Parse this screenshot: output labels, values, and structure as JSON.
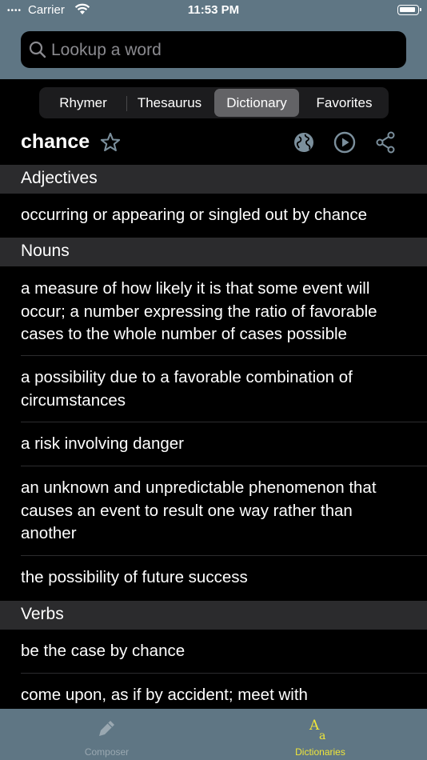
{
  "status_bar": {
    "carrier": "Carrier",
    "time": "11:53 PM",
    "dots": "••••"
  },
  "search": {
    "placeholder": "Lookup a word",
    "icon": "search-icon"
  },
  "segments": {
    "items": [
      "Rhymer",
      "Thesaurus",
      "Dictionary",
      "Favorites"
    ],
    "selected": "Dictionary"
  },
  "entry": {
    "word": "chance",
    "icons": [
      "star-icon",
      "globe-icon",
      "play-icon",
      "share-icon"
    ]
  },
  "sections": [
    {
      "title": "Adjectives",
      "definitions": [
        "occurring or appearing or singled out by chance"
      ]
    },
    {
      "title": "Nouns",
      "definitions": [
        "a measure of how likely it is that some event will occur; a number expressing the ratio of favorable cases to the whole number of cases possible",
        "a possibility due to a favorable combination of circumstances",
        "a risk involving danger",
        "an unknown and unpredictable phenomenon that causes an event to result one way rather than another",
        "the possibility of future success"
      ]
    },
    {
      "title": "Verbs",
      "definitions": [
        "be the case by chance",
        "come upon, as if by accident; meet with"
      ]
    }
  ],
  "tabbar": {
    "tabs": [
      {
        "label": "Composer",
        "icon": "pencil-icon"
      },
      {
        "label": "Dictionaries",
        "icon": "font-aa-icon"
      }
    ],
    "selected": "Dictionaries"
  },
  "colors": {
    "header": "#5f7684",
    "section_header": "#2b2b2d",
    "active_tab": "#f0e63a",
    "inactive_tab": "#9aa8b1"
  }
}
